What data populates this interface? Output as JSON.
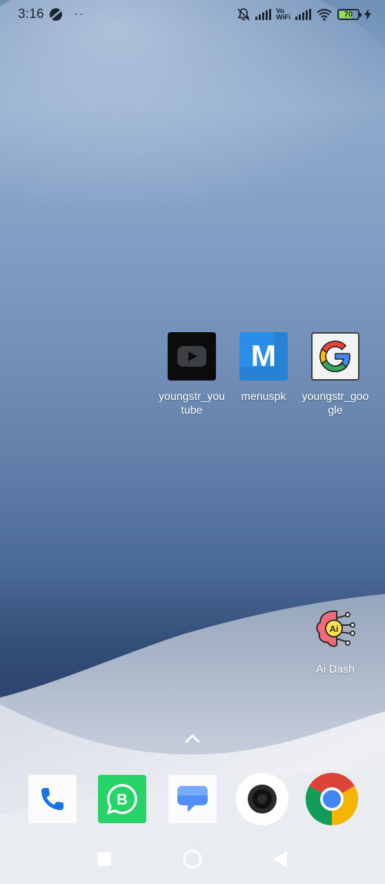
{
  "status_bar": {
    "time": "3:16",
    "more": "··",
    "vo_top": "Vo",
    "vo_bottom": "WiFi",
    "battery_level": "70",
    "battery_fraction": 0.7,
    "battery_color": "#8fe04a"
  },
  "home_apps": [
    {
      "label": "youngstr_youtube",
      "icon": "youtube-icon"
    },
    {
      "label": "menuspk",
      "icon": "menuspk-icon",
      "glyph": "M"
    },
    {
      "label": "youngstr_google",
      "icon": "google-icon"
    },
    {
      "label": "Ai Dash",
      "icon": "ai-dash-icon",
      "glyph": "Ai"
    }
  ],
  "dock": [
    {
      "app": "Phone",
      "icon": "phone-icon"
    },
    {
      "app": "WhatsApp Business",
      "icon": "whatsapp-business-icon",
      "glyph": "B"
    },
    {
      "app": "Messages",
      "icon": "messages-icon"
    },
    {
      "app": "Camera",
      "icon": "camera-icon"
    },
    {
      "app": "Chrome",
      "icon": "chrome-icon"
    }
  ],
  "nav": {
    "recents": "recents-icon",
    "home": "home-icon",
    "back": "back-icon"
  },
  "colors": {
    "youtube_bg": "#0b0b0b",
    "menuspk_bg": "#2a8ee8",
    "whatsapp_green": "#25d366",
    "chrome_red": "#db4437",
    "chrome_yellow": "#f4b400",
    "chrome_green": "#0f9d58",
    "chrome_blue": "#4285f4"
  }
}
